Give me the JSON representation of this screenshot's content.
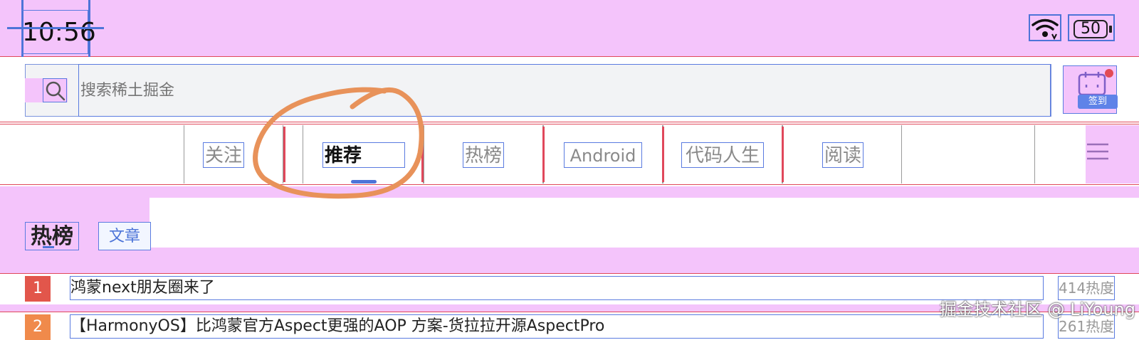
{
  "status_bar": {
    "time": "10:56",
    "battery": "50"
  },
  "search": {
    "placeholder": "搜索稀土掘金"
  },
  "signin": {
    "label": "签到"
  },
  "tabs": [
    {
      "label": "关注"
    },
    {
      "label": "推荐",
      "active": true
    },
    {
      "label": "热榜"
    },
    {
      "label": "Android"
    },
    {
      "label": "代码人生"
    },
    {
      "label": "阅读"
    }
  ],
  "hot": {
    "title": "热榜",
    "tag": "文章"
  },
  "list": [
    {
      "rank": "1",
      "title": "鸿蒙next朋友圈来了",
      "heat": "414热度",
      "color": "#e2564b"
    },
    {
      "rank": "2",
      "title": "【HarmonyOS】比鸿蒙官方Aspect更强的AOP 方案-货拉拉开源AspectPro",
      "heat": "261热度",
      "color": "#f08a4b"
    }
  ],
  "watermark": "掘金技术社区 @ LiYoung",
  "colors": {
    "accent": "#4d74d8",
    "overlay_pink": "#f4c4fb",
    "annotation_orange": "#e8925a"
  }
}
